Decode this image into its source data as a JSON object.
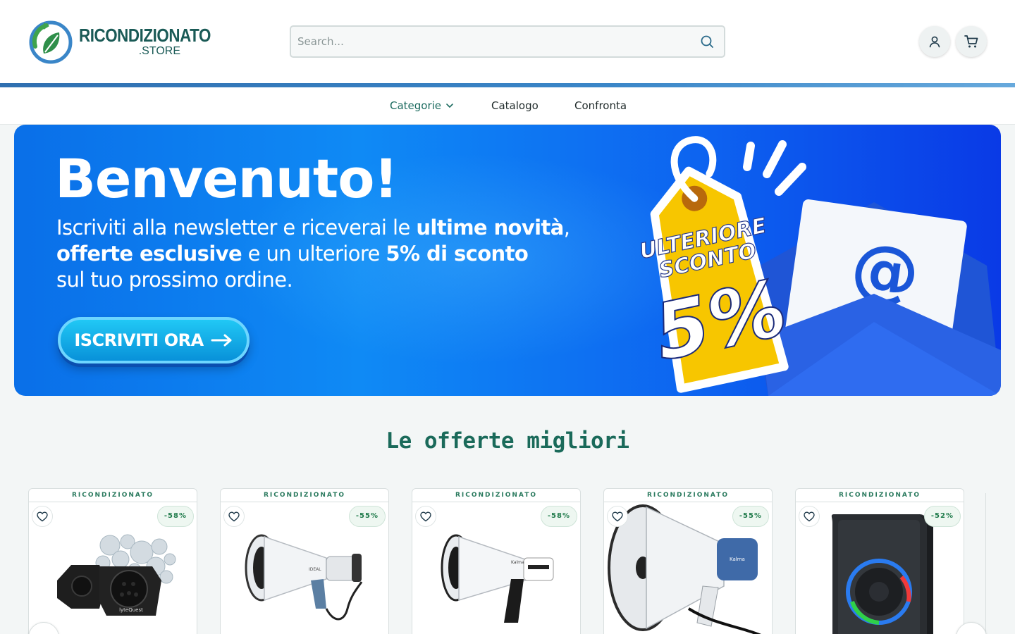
{
  "header": {
    "logo_main": "RICONDIZIONATO",
    "logo_sub": ".STORE",
    "search_placeholder": "Search..."
  },
  "nav": {
    "categories": "Categorie",
    "catalog": "Catalogo",
    "compare": "Confronta"
  },
  "banner": {
    "title": "Benvenuto!",
    "text_1": "Iscriviti alla newsletter e riceverai le ",
    "text_1_bold": "ultime novità",
    "text_1_end": ",",
    "text_2_bold": "offerte esclusive",
    "text_2": " e un ulteriore ",
    "text_2_bold_b": "5% di sconto",
    "text_3": "sul tuo prossimo ordine.",
    "cta": "ISCRIVITI ORA",
    "tag_line_1": "ULTERIORE",
    "tag_line_2": "SCONTO",
    "tag_value": "5%"
  },
  "section_title": "Le offerte migliori",
  "products": [
    {
      "tag": "RICONDIZIONATO",
      "discount": "-58%"
    },
    {
      "tag": "RICONDIZIONATO",
      "discount": "-55%"
    },
    {
      "tag": "RICONDIZIONATO",
      "discount": "-58%"
    },
    {
      "tag": "RICONDIZIONATO",
      "discount": "-55%"
    },
    {
      "tag": "RICONDIZIONATO",
      "discount": "-52%"
    }
  ],
  "colors": {
    "brand_green": "#1a6a5a",
    "brand_blue": "#3a78b8",
    "banner_blue": "#0a6fe8",
    "tag_yellow": "#f7c600"
  },
  "icons": [
    "search-icon",
    "user-icon",
    "cart-icon",
    "chevron-down-icon",
    "heart-icon",
    "arrow-right-icon"
  ]
}
